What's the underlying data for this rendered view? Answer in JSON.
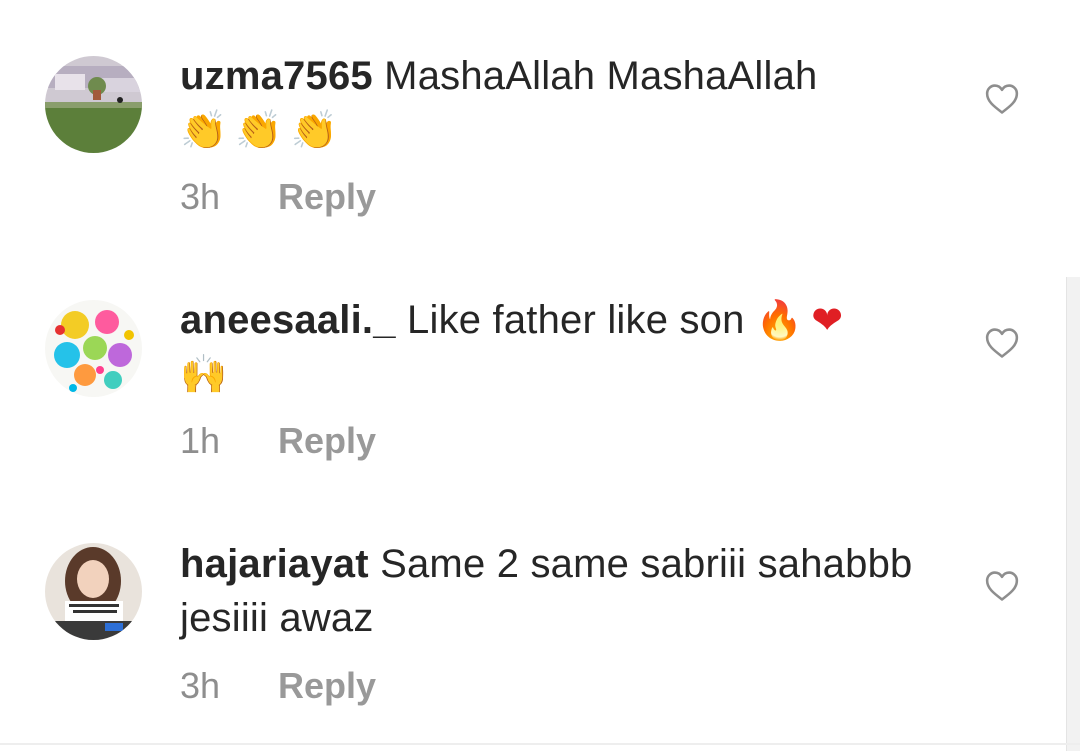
{
  "comments": [
    {
      "avatar_icon": "garden-photo-avatar",
      "username": "uzma7565",
      "body": "MashaAllah MashaAllah",
      "emoji": "👏👏👏",
      "time": "3h",
      "reply_label": "Reply",
      "like_icon": "heart-outline-icon"
    },
    {
      "avatar_icon": "paint-splash-avatar",
      "username": "aneesaali._",
      "body": "Like father like son",
      "emoji_inline": [
        "🔥",
        "❤"
      ],
      "emoji": "🙌",
      "time": "1h",
      "reply_label": "Reply",
      "like_icon": "heart-outline-icon"
    },
    {
      "avatar_icon": "girl-photo-avatar",
      "username": "hajariayat",
      "body": "Same 2 same sabriii sahabbb jesiiii awaz",
      "time": "3h",
      "reply_label": "Reply",
      "like_icon": "heart-outline-icon"
    }
  ],
  "colors": {
    "text": "#262626",
    "meta": "#8e8e8e",
    "background": "#ffffff"
  }
}
